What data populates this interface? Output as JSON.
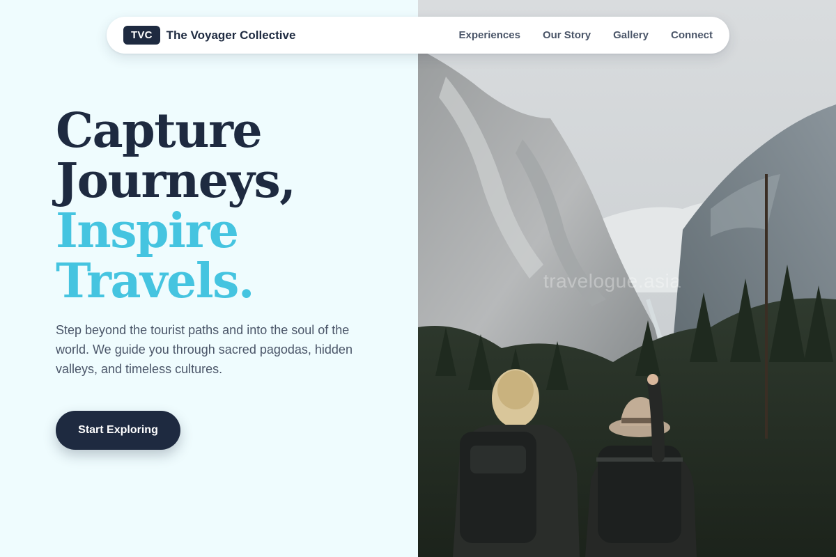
{
  "nav": {
    "logo_badge": "TVC",
    "brand_name": "The Voyager Collective",
    "links": [
      "Experiences",
      "Our Story",
      "Gallery",
      "Connect"
    ]
  },
  "hero": {
    "headline_line1": "Capture",
    "headline_line2": "Journeys,",
    "headline_line3": "Inspire",
    "headline_line4": "Travels.",
    "lead": "Step beyond the tourist paths and into the soul of the world. We guide you through sacred pagodas, hidden valleys, and timeless cultures.",
    "cta_label": "Start Exploring"
  },
  "image": {
    "watermark": "travelogue.asia",
    "subject": "hikers-overlooking-mountain-valley"
  },
  "colors": {
    "background": "#effcfe",
    "dark": "#1e2a40",
    "accent": "#45c4e0",
    "body_text": "#4a5568"
  }
}
